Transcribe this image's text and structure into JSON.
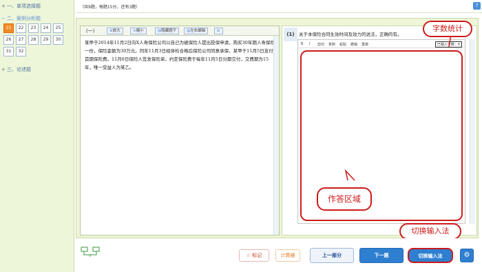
{
  "sidebar": {
    "sections": [
      {
        "sign": "+",
        "label": "一、单项选择题"
      },
      {
        "sign": "−",
        "label": "二、案例分析题"
      },
      {
        "sign": "+",
        "label": "三、论述题"
      }
    ],
    "questions": [
      "21",
      "22",
      "23",
      "24",
      "25",
      "26",
      "27",
      "28",
      "29",
      "30",
      "31",
      "32"
    ],
    "active_question": "21"
  },
  "topbar": {
    "info": "（共9题，每题15分，还有3题）",
    "help_icon": "?"
  },
  "question_panel": {
    "label": "(一)",
    "toolbar": [
      {
        "icon": "⊕",
        "label": "放大"
      },
      {
        "icon": "⊖",
        "label": "缩小"
      },
      {
        "icon": "▤",
        "label": "隐藏题干"
      },
      {
        "icon": "▥",
        "label": "左右编辑"
      },
      {
        "icon": "⊟",
        "label": ""
      }
    ],
    "text": "某甲于2014年11月2日向X人寿保险公司以自己为被保险人提出投保申请，购买30年期人寿保险一份，保险金额为30万元。同年11月3日经体检合格后保险公司同意承保，某甲于11月5日支付首期保险费。11月8日保险人签发保险单，约定保险费于每年11月5日分期交付，交费期为15年，唯一受益人为某乙。"
  },
  "answer_panel": {
    "number": "(1)",
    "prompt": "关于本保险合同生效时间及效力的说法，正确的有。",
    "editor_tools": [
      "B",
      "I",
      "剪切",
      "复制",
      "粘贴",
      "撤销",
      "重做"
    ],
    "word_count_label": "已输入字数：0"
  },
  "callouts": {
    "word_count": "字数统计",
    "answer_area": "作答区域",
    "switch_ime": "切换输入法"
  },
  "bottom": {
    "mark": "☆ 标记",
    "calculator": "计算器",
    "prev_part": "上一部分",
    "next": "下一题",
    "switch_ime": "切换输入法",
    "settings_icon": "⚙"
  },
  "colors": {
    "accent": "#cc1a1a",
    "primary": "#2f7fd1",
    "active_question": "#f08a24",
    "panel_bg": "#eef6d9"
  }
}
